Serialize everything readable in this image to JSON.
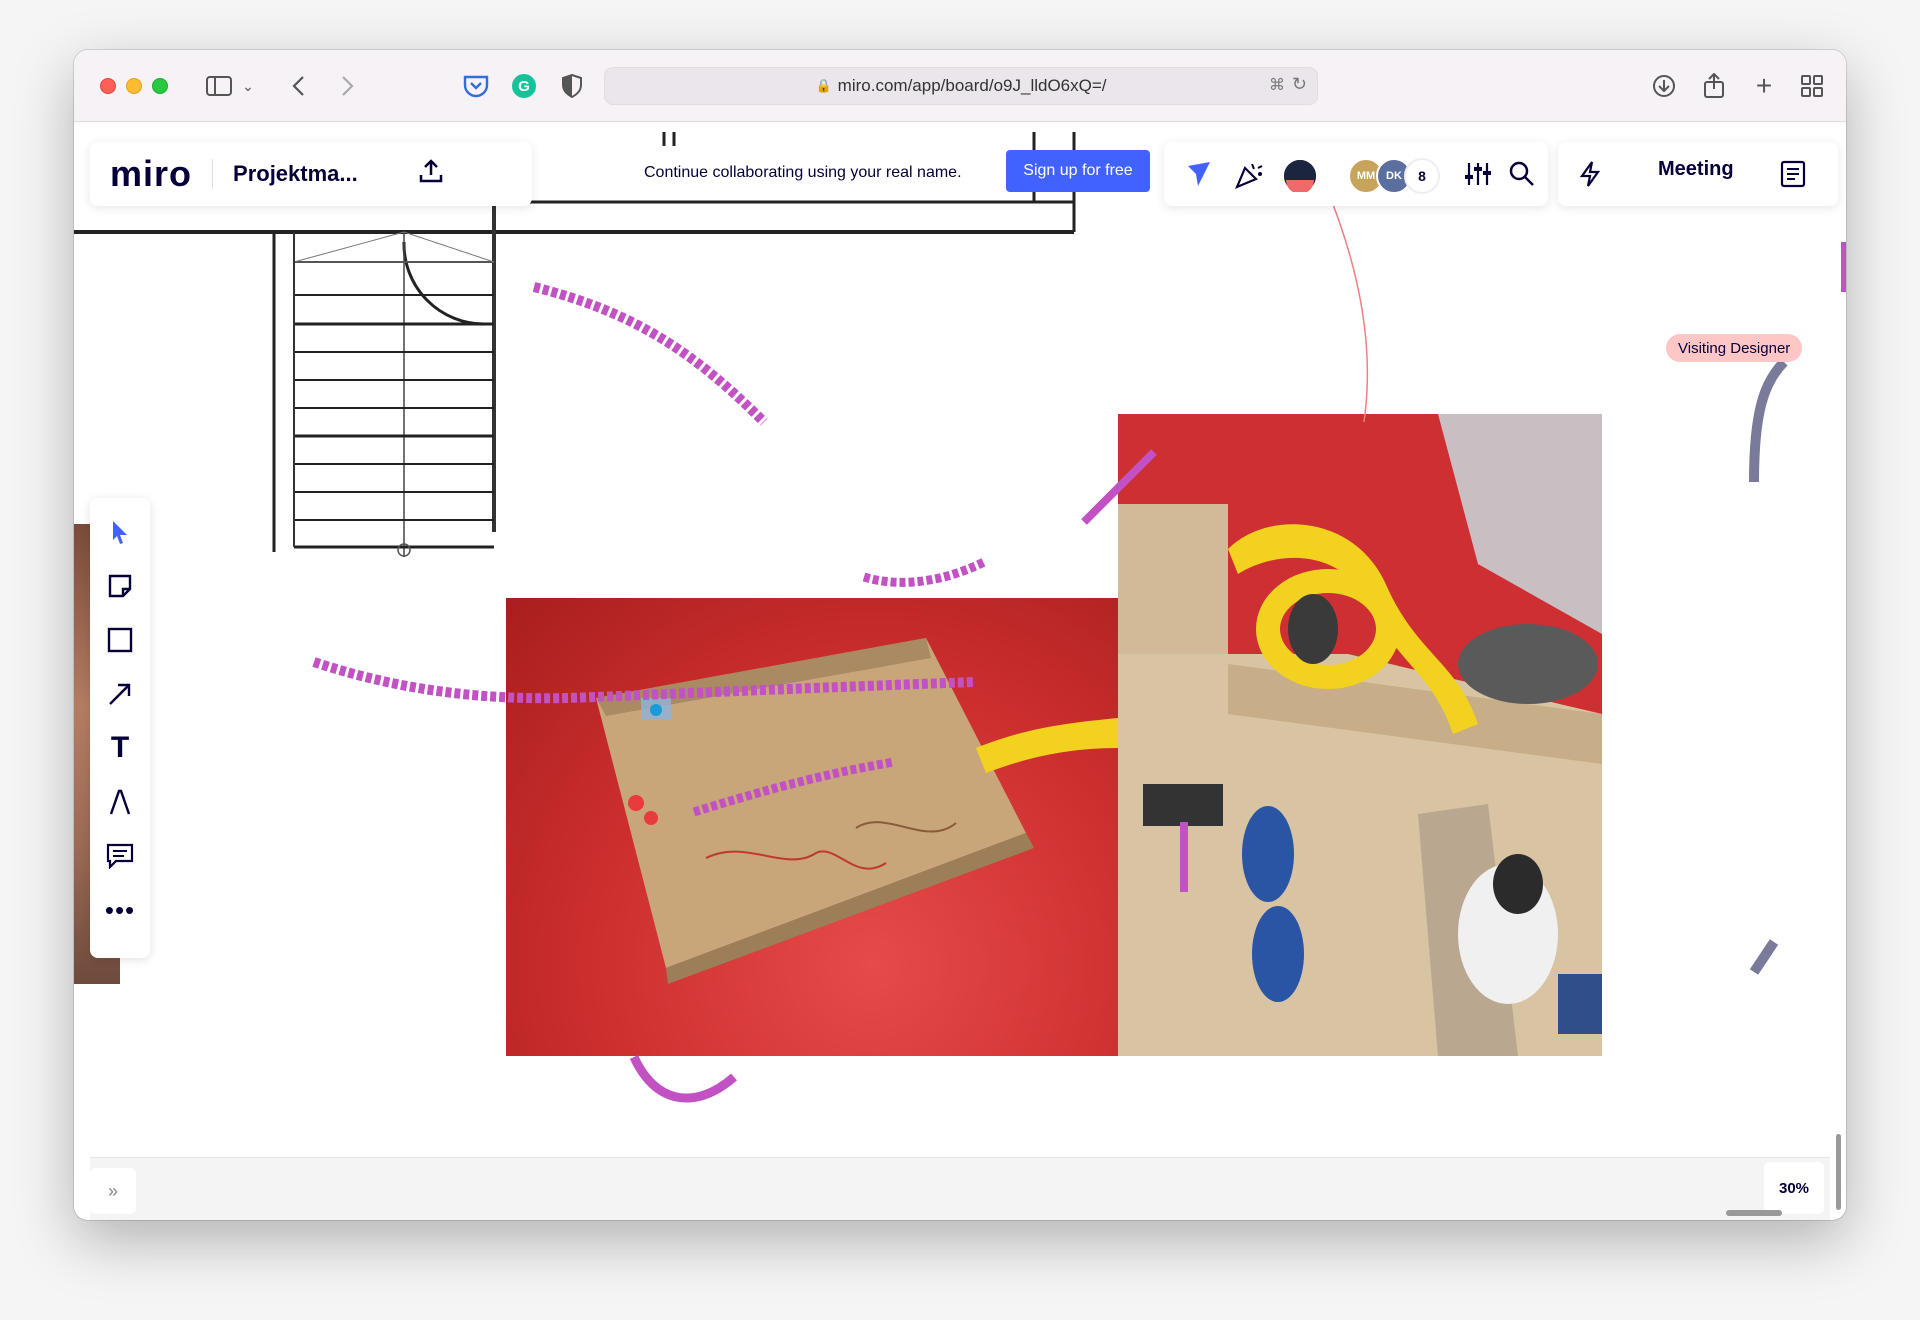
{
  "browser": {
    "url": "miro.com/app/board/o9J_lldO6xQ=/"
  },
  "miro": {
    "logo": "miro",
    "board_name": "Projektma...",
    "banner_text": "Continue collaborating using your real name.",
    "signup_label": "Sign up for free",
    "avatars": [
      "MM",
      "DK"
    ],
    "collaborator_count": "8",
    "meeting_label": "Meeting",
    "visiting_label": "Visiting Designer",
    "zoom_level": "30%",
    "expand_label": "»"
  },
  "colors": {
    "accent": "#4262ff",
    "cursor_trail": "#c251c4",
    "visiting_badge": "#ffc6c6"
  },
  "icons": {
    "select": "cursor-icon",
    "sticky": "sticky-note-icon",
    "shape": "square-icon",
    "arrow": "arrow-icon",
    "text": "text-icon",
    "pen": "pen-icon",
    "comment": "comment-icon",
    "more": "more-icon"
  }
}
